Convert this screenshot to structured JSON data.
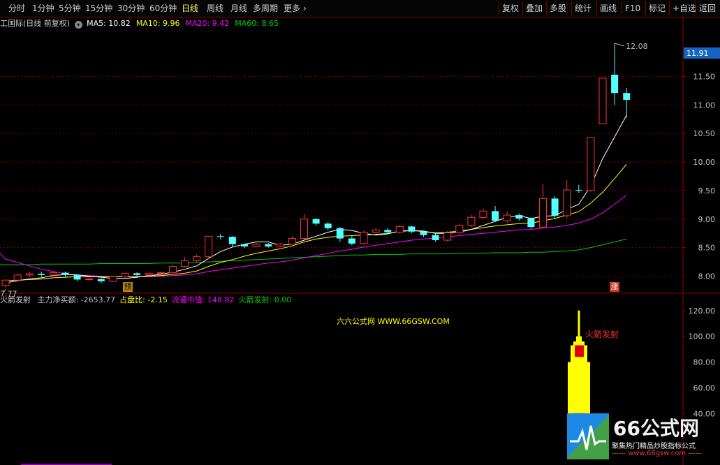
{
  "toolbar": {
    "periods": [
      "分时",
      "1分钟",
      "5分钟",
      "15分钟",
      "30分钟",
      "60分钟",
      "日线",
      "周线",
      "月线",
      "多周期",
      "更多"
    ],
    "active_period": "日线",
    "more_icon": "chevron-right-icon",
    "right_buttons": [
      "复权",
      "叠加",
      "多股",
      "统计",
      "画线",
      "F10",
      "标记",
      "+自选",
      "返回"
    ]
  },
  "main_legend": {
    "title": "工国际(日线 前复权)",
    "settings_icon": "chevron-down-circle-icon",
    "ma": [
      {
        "label": "MA5: 10.82",
        "color": "#ffffff"
      },
      {
        "label": "MA10: 9.96",
        "color": "#ffff00"
      },
      {
        "label": "MA20: 9.42",
        "color": "#ff00ff"
      },
      {
        "label": "MA60: 8.65",
        "color": "#00cc00"
      }
    ]
  },
  "indicator_legend": {
    "name": "火箭发射",
    "items": [
      {
        "label": "主力净买额: -2653.77",
        "color": "#c0c0c0"
      },
      {
        "label": "占盘比: -2.15",
        "color": "#ffff00"
      },
      {
        "label": "流通市值: 148.82",
        "color": "#ff00ff"
      },
      {
        "label": "火箭发射: 0.00",
        "color": "#00cc00"
      }
    ]
  },
  "watermark_text": "六六公式网 WWW.66GSW.COM",
  "rocket_label": "火箭发射",
  "markers": {
    "yu": "预",
    "zhang": "涨"
  },
  "logo": {
    "text": "66公式网",
    "tagline": "聚集热门精品炒股指标公式",
    "url": "—— www.66gsw.com ——"
  },
  "colors": {
    "up": "#ff3232",
    "down": "#54ffff",
    "ma5": "#ffffff",
    "ma10": "#ffff00",
    "ma20": "#ff00ff",
    "ma60": "#00cc00",
    "rocket": "#ffff00"
  },
  "chart_data": [
    {
      "type": "candlestick",
      "title": "工国际(日线 前复权)",
      "ylim": [
        7.7,
        12.35
      ],
      "y_ticks": [
        8.0,
        8.5,
        9.0,
        9.5,
        10.0,
        10.5,
        11.0,
        11.5
      ],
      "y_tick_labels": [
        "8.00",
        "8.50",
        "9.00",
        "9.50",
        "10.00",
        "10.50",
        "11.00",
        "11.50"
      ],
      "current_price": 11.91,
      "current_price_label": "11.91",
      "high_label": "12.08",
      "high_value": 12.08,
      "low_label": "7.77",
      "low_value": 7.77,
      "candles": [
        [
          7.84,
          7.93,
          7.94,
          7.8
        ],
        [
          7.93,
          8.02,
          8.04,
          7.9
        ],
        [
          8.02,
          8.04,
          8.08,
          7.98
        ],
        [
          8.04,
          8.02,
          8.08,
          7.99
        ],
        [
          8.02,
          8.06,
          8.08,
          8.0
        ],
        [
          8.06,
          8.02,
          8.08,
          7.98
        ],
        [
          8.02,
          7.94,
          8.03,
          7.91
        ],
        [
          7.94,
          7.95,
          7.97,
          7.92
        ],
        [
          7.95,
          7.91,
          7.96,
          7.88
        ],
        [
          7.91,
          7.99,
          8.0,
          7.9
        ],
        [
          7.99,
          8.05,
          8.06,
          7.97
        ],
        [
          8.05,
          8.02,
          8.07,
          8.0
        ],
        [
          8.02,
          8.05,
          8.06,
          8.0
        ],
        [
          8.05,
          8.06,
          8.08,
          8.03
        ],
        [
          8.06,
          8.17,
          8.2,
          8.05
        ],
        [
          8.17,
          8.27,
          8.33,
          8.15
        ],
        [
          8.27,
          8.34,
          8.38,
          8.24
        ],
        [
          8.34,
          8.7,
          8.7,
          8.3
        ],
        [
          8.7,
          8.69,
          8.74,
          8.64
        ],
        [
          8.69,
          8.56,
          8.7,
          8.5
        ],
        [
          8.56,
          8.52,
          8.57,
          8.49
        ],
        [
          8.52,
          8.56,
          8.58,
          8.51
        ],
        [
          8.56,
          8.52,
          8.58,
          8.5
        ],
        [
          8.52,
          8.56,
          8.58,
          8.51
        ],
        [
          8.56,
          8.66,
          8.7,
          8.55
        ],
        [
          8.66,
          9.0,
          9.09,
          8.64
        ],
        [
          9.0,
          8.92,
          9.02,
          8.88
        ],
        [
          8.92,
          8.84,
          8.95,
          8.8
        ],
        [
          8.84,
          8.66,
          8.86,
          8.6
        ],
        [
          8.66,
          8.57,
          8.7,
          8.54
        ],
        [
          8.57,
          8.77,
          8.8,
          8.55
        ],
        [
          8.77,
          8.81,
          8.84,
          8.75
        ],
        [
          8.81,
          8.77,
          8.84,
          8.74
        ],
        [
          8.77,
          8.87,
          8.89,
          8.75
        ],
        [
          8.87,
          8.78,
          8.88,
          8.75
        ],
        [
          8.78,
          8.72,
          8.8,
          8.69
        ],
        [
          8.72,
          8.63,
          8.75,
          8.6
        ],
        [
          8.63,
          8.76,
          8.79,
          8.61
        ],
        [
          8.76,
          8.89,
          8.92,
          8.74
        ],
        [
          8.89,
          9.03,
          9.07,
          8.86
        ],
        [
          9.03,
          9.14,
          9.18,
          9.0
        ],
        [
          9.14,
          8.97,
          9.23,
          8.95
        ],
        [
          8.97,
          9.07,
          9.14,
          8.94
        ],
        [
          9.07,
          9.01,
          9.1,
          8.97
        ],
        [
          9.01,
          8.86,
          9.03,
          8.83
        ],
        [
          8.86,
          9.36,
          9.62,
          8.84
        ],
        [
          9.36,
          9.06,
          9.4,
          9.01
        ],
        [
          9.06,
          9.51,
          9.68,
          9.02
        ],
        [
          9.51,
          9.5,
          9.6,
          9.46
        ],
        [
          9.5,
          10.43,
          10.43,
          9.48
        ],
        [
          10.67,
          11.47,
          11.47,
          10.67
        ],
        [
          11.53,
          11.21,
          12.08,
          11.0
        ],
        [
          11.21,
          11.09,
          11.3,
          10.78
        ]
      ],
      "ma5": [
        7.88,
        7.92,
        7.95,
        7.97,
        8.01,
        8.03,
        8.02,
        8.0,
        7.98,
        7.96,
        7.96,
        7.98,
        8.01,
        8.03,
        8.07,
        8.12,
        8.18,
        8.31,
        8.43,
        8.51,
        8.56,
        8.6,
        8.6,
        8.54,
        8.56,
        8.63,
        8.7,
        8.77,
        8.82,
        8.8,
        8.75,
        8.72,
        8.74,
        8.79,
        8.8,
        8.79,
        8.75,
        8.75,
        8.77,
        8.82,
        8.89,
        8.96,
        9.03,
        9.06,
        9.01,
        9.05,
        9.06,
        9.17,
        9.26,
        9.58,
        10.06,
        10.44,
        10.82
      ],
      "ma10": [
        7.92,
        7.93,
        7.94,
        7.95,
        7.97,
        7.98,
        7.99,
        7.99,
        7.99,
        7.99,
        7.99,
        7.99,
        8.0,
        8.01,
        8.03,
        8.05,
        8.09,
        8.17,
        8.24,
        8.29,
        8.35,
        8.4,
        8.44,
        8.48,
        8.53,
        8.6,
        8.65,
        8.68,
        8.7,
        8.71,
        8.72,
        8.73,
        8.75,
        8.78,
        8.8,
        8.78,
        8.76,
        8.77,
        8.79,
        8.82,
        8.85,
        8.88,
        8.9,
        8.92,
        8.93,
        8.97,
        9.01,
        9.07,
        9.13,
        9.28,
        9.47,
        9.71,
        9.96
      ],
      "ma20": [
        8.3,
        8.24,
        8.18,
        8.12,
        8.08,
        8.04,
        8.02,
        8.01,
        8.0,
        7.99,
        7.99,
        7.99,
        7.99,
        8.0,
        8.01,
        8.02,
        8.04,
        8.08,
        8.11,
        8.14,
        8.17,
        8.2,
        8.23,
        8.25,
        8.28,
        8.32,
        8.36,
        8.4,
        8.44,
        8.47,
        8.51,
        8.54,
        8.57,
        8.6,
        8.63,
        8.65,
        8.67,
        8.69,
        8.71,
        8.73,
        8.75,
        8.77,
        8.79,
        8.81,
        8.82,
        8.84,
        8.86,
        8.89,
        8.93,
        9.0,
        9.11,
        9.26,
        9.42
      ],
      "ma60": [
        8.2,
        8.2,
        8.2,
        8.21,
        8.21,
        8.21,
        8.21,
        8.21,
        8.22,
        8.22,
        8.22,
        8.22,
        8.22,
        8.23,
        8.23,
        8.23,
        8.24,
        8.25,
        8.26,
        8.27,
        8.28,
        8.29,
        8.3,
        8.31,
        8.32,
        8.33,
        8.34,
        8.35,
        8.36,
        8.37,
        8.37,
        8.38,
        8.38,
        8.38,
        8.39,
        8.39,
        8.39,
        8.39,
        8.4,
        8.4,
        8.4,
        8.41,
        8.41,
        8.41,
        8.42,
        8.42,
        8.43,
        8.44,
        8.46,
        8.5,
        8.55,
        8.6,
        8.65
      ]
    },
    {
      "type": "bar",
      "title": "火箭发射",
      "ylim": [
        0,
        128
      ],
      "y_ticks": [
        40,
        60,
        80,
        100,
        120
      ],
      "y_tick_labels": [
        "40.00",
        "60.00",
        "80.00",
        "100.00",
        "120.00"
      ],
      "rocket": {
        "top": 120,
        "nose_top": 100,
        "neck_top": 96,
        "shoulder": 93,
        "body_top": 80,
        "body_bottom": 10,
        "red_block": [
          84,
          93
        ],
        "blue_mark": 40
      }
    }
  ]
}
